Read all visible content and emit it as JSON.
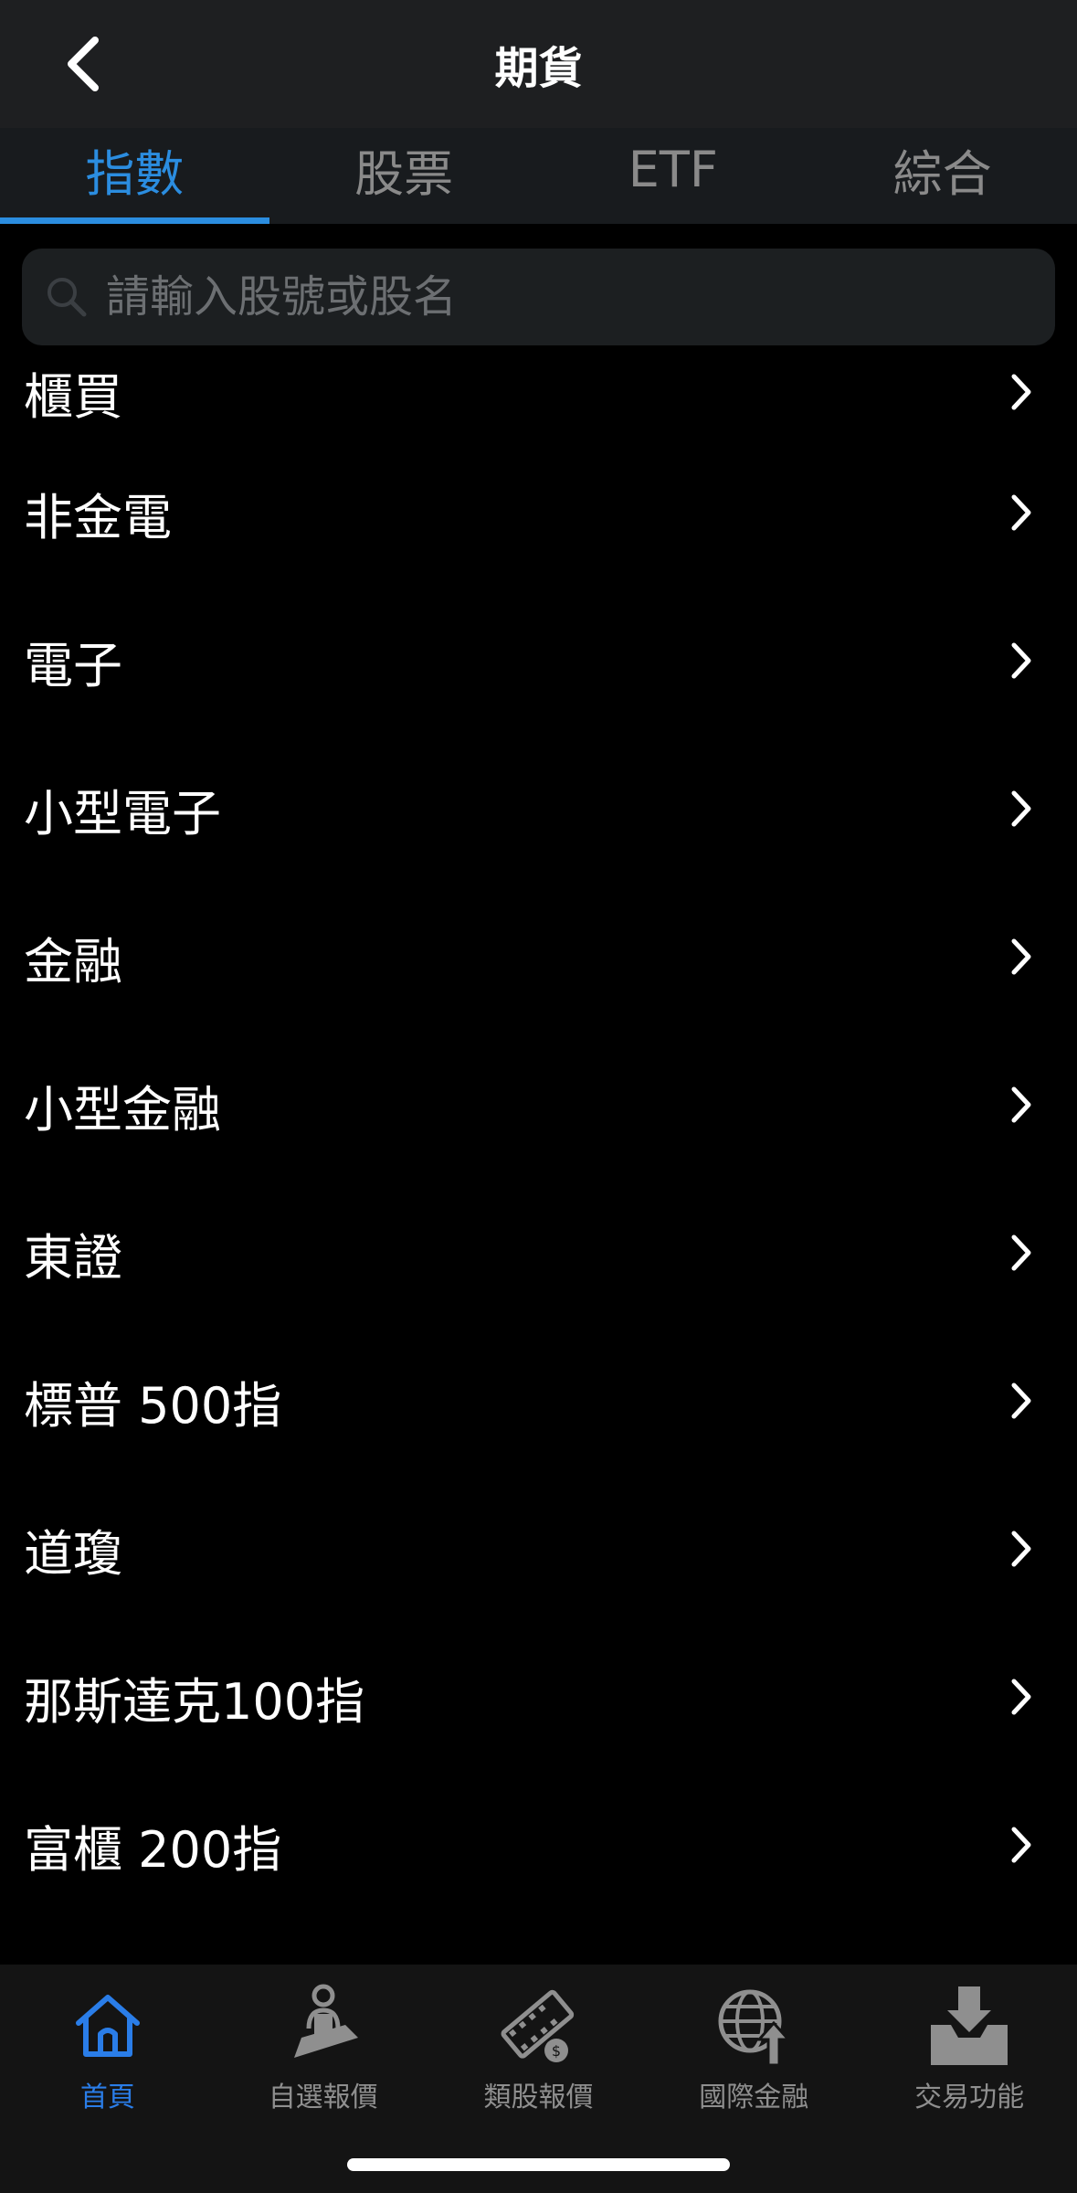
{
  "header": {
    "title": "期貨",
    "back_icon": "chevron-left-icon"
  },
  "tabs": [
    {
      "label": "指數",
      "active": true
    },
    {
      "label": "股票",
      "active": false
    },
    {
      "label": "ETF",
      "active": false
    },
    {
      "label": "綜合",
      "active": false
    }
  ],
  "search": {
    "placeholder": "請輸入股號或股名",
    "value": "",
    "icon": "search-icon"
  },
  "list": {
    "items": [
      {
        "label": "櫃買"
      },
      {
        "label": "非金電"
      },
      {
        "label": "電子"
      },
      {
        "label": "小型電子"
      },
      {
        "label": "金融"
      },
      {
        "label": "小型金融"
      },
      {
        "label": "東證"
      },
      {
        "label": "標普 500指"
      },
      {
        "label": "道瓊"
      },
      {
        "label": "那斯達克100指"
      },
      {
        "label": "富櫃 200指"
      }
    ],
    "item_icon": "chevron-right-icon"
  },
  "tabbar": {
    "items": [
      {
        "label": "首頁",
        "icon": "home-icon",
        "active": true
      },
      {
        "label": "自選報價",
        "icon": "person-desk-icon",
        "active": false
      },
      {
        "label": "類股報價",
        "icon": "film-coin-icon",
        "active": false
      },
      {
        "label": "國際金融",
        "icon": "globe-arrow-icon",
        "active": false
      },
      {
        "label": "交易功能",
        "icon": "tray-download-icon",
        "active": false
      }
    ]
  },
  "colors": {
    "accent": "#2b8de0",
    "tabbar_active": "#2a7de8",
    "background": "#000000",
    "header_bg": "#1e1f21"
  }
}
